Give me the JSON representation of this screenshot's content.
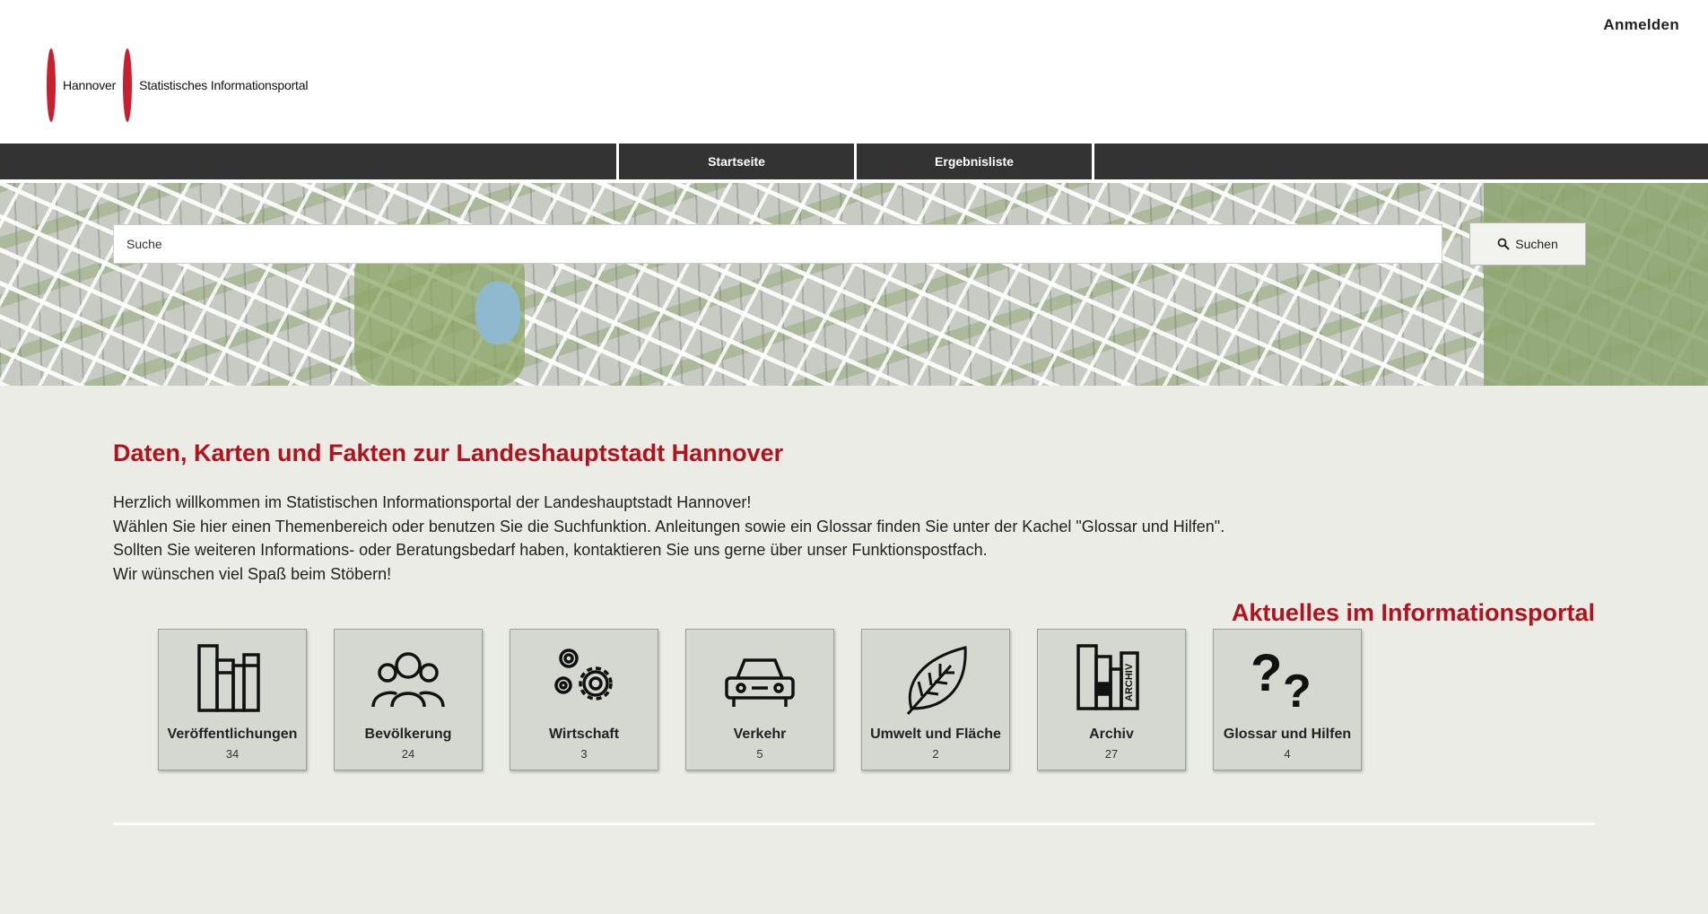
{
  "header": {
    "logo_city": "Hannover",
    "logo_portal": "Statistisches Informationsportal",
    "login_label": "Anmelden",
    "brand_color": "#c8202f"
  },
  "nav": {
    "items": [
      {
        "label": "Startseite"
      },
      {
        "label": "Ergebnisliste"
      }
    ]
  },
  "search": {
    "placeholder": "Suche",
    "button_label": "Suchen",
    "button_icon": "search-icon"
  },
  "main": {
    "title": "Daten, Karten und Fakten zur Landeshauptstadt Hannover",
    "intro_lines": [
      "Herzlich willkommen im Statistischen Informationsportal der Landeshauptstadt Hannover!",
      "Wählen Sie hier einen Themenbereich oder benutzen Sie die Suchfunktion. Anleitungen sowie ein Glossar finden Sie unter der Kachel \"Glossar und Hilfen\".",
      "Sollten Sie weiteren Informations- oder Beratungsbedarf haben, kontaktieren Sie uns gerne über unser Funktionspostfach.",
      "Wir wünschen viel Spaß beim Stöbern!"
    ],
    "accent_color": "#b3121c"
  },
  "tiles": [
    {
      "label": "Veröffentlichungen",
      "count": "34",
      "icon": "books-icon"
    },
    {
      "label": "Bevölkerung",
      "count": "24",
      "icon": "people-icon"
    },
    {
      "label": "Wirtschaft",
      "count": "3",
      "icon": "gears-icon"
    },
    {
      "label": "Verkehr",
      "count": "5",
      "icon": "car-icon"
    },
    {
      "label": "Umwelt und Fläche",
      "count": "2",
      "icon": "leaf-icon"
    },
    {
      "label": "Archiv",
      "count": "27",
      "icon": "archive-icon"
    },
    {
      "label": "Glossar und Hilfen",
      "count": "4",
      "icon": "question-marks-icon"
    }
  ],
  "news": {
    "title": "Aktuelles im Informationsportal"
  }
}
